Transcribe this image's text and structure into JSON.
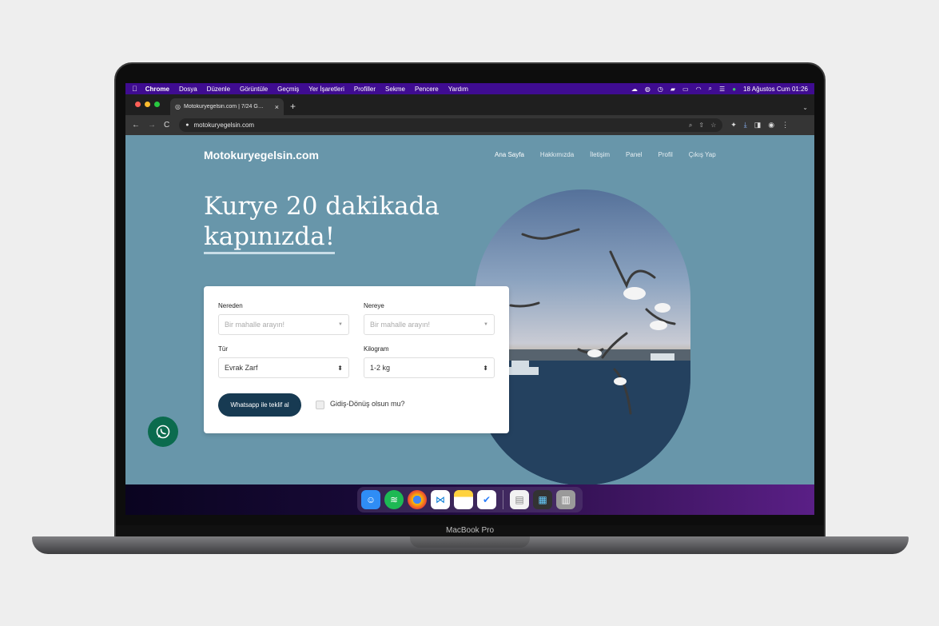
{
  "menubar": {
    "apple": "",
    "items": [
      "Chrome",
      "Dosya",
      "Düzenle",
      "Görüntüle",
      "Geçmiş",
      "Yer İşaretleri",
      "Profiller",
      "Sekme",
      "Pencere",
      "Yardım"
    ],
    "datetime": "18 Ağustos Cum  01:26"
  },
  "browser": {
    "tab_title": "Motokuryegelsin.com | 7/24 G…",
    "url": "motokuryegelsin.com"
  },
  "site": {
    "brand": "Motokuryegelsin.com",
    "nav": [
      "Ana Sayfa",
      "Hakkımızda",
      "İletişim",
      "Panel",
      "Profil",
      "Çıkış Yap"
    ],
    "hero_line1": "Kurye 20 dakikada",
    "hero_line2": "kapınızda!"
  },
  "form": {
    "from_label": "Nereden",
    "from_placeholder": "Bir mahalle arayın!",
    "to_label": "Nereye",
    "to_placeholder": "Bir mahalle arayın!",
    "type_label": "Tür",
    "type_value": "Evrak Zarf",
    "weight_label": "Kilogram",
    "weight_value": "1-2 kg",
    "submit_label": "Whatsapp ile teklif al",
    "roundtrip_label": "Gidiş-Dönüş olsun mu?"
  },
  "laptop_label": "MacBook Pro",
  "colors": {
    "page_bg": "#6896aa",
    "menubar": "#3f0c91",
    "button": "#173a52",
    "whatsapp": "#0b6b4e"
  }
}
